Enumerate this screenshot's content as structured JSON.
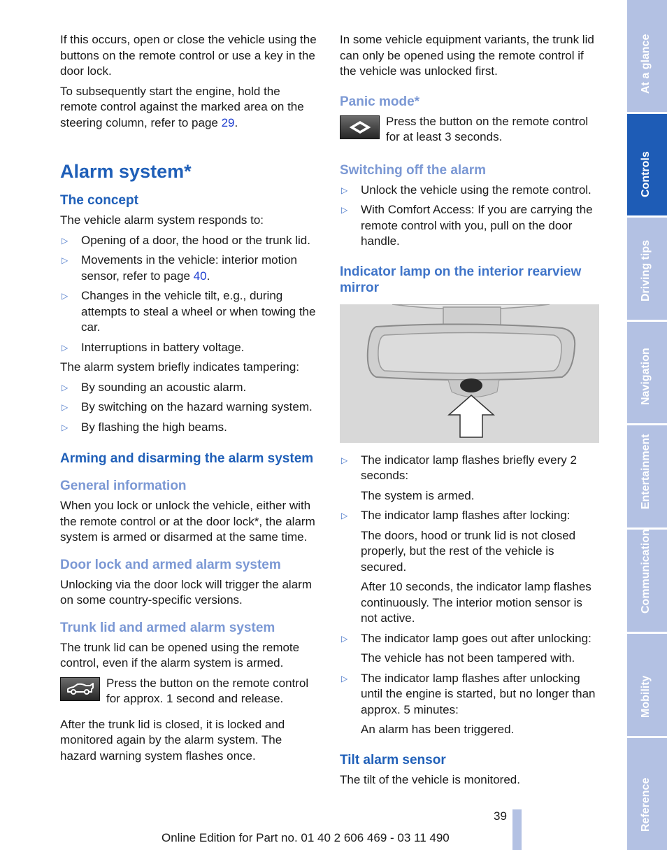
{
  "left_column": {
    "intro_p1": "If this occurs, open or close the vehicle using the buttons on the remote control or use a key in the door lock.",
    "intro_p2_text": "To subsequently start the engine, hold the remote control against the marked area on the steering column, refer to page ",
    "intro_p2_link": "29",
    "intro_p2_end": ".",
    "title": "Alarm system*",
    "concept_heading": "The concept",
    "concept_intro": "The vehicle alarm system responds to:",
    "concept_items": [
      {
        "text": "Opening of a door, the hood or the trunk lid."
      },
      {
        "text": "Movements in the vehicle: interior motion sensor, refer to page ",
        "link": "40",
        "end": "."
      },
      {
        "text": "Changes in the vehicle tilt, e.g., during attempts to steal a wheel or when towing the car."
      },
      {
        "text": "Interruptions in battery voltage."
      }
    ],
    "tamper_intro": "The alarm system briefly indicates tampering:",
    "tamper_items": [
      "By sounding an acoustic alarm.",
      "By switching on the hazard warning system.",
      "By flashing the high beams."
    ],
    "arming_heading": "Arming and disarming the alarm system",
    "general_heading": "General information",
    "general_text": "When you lock or unlock the vehicle, either with the remote control or at the door lock*, the alarm system is armed or disarmed at the same time.",
    "doorlock_heading": "Door lock and armed alarm system",
    "doorlock_text": "Unlocking via the door lock will trigger the alarm on some country-specific versions.",
    "trunk_heading": "Trunk lid and armed alarm system",
    "trunk_text": "The trunk lid can be opened using the remote control, even if the alarm system is armed.",
    "trunk_button_icon": "trunk-car-icon",
    "trunk_button_text": "Press the button on the remote control for approx. 1 second and release.",
    "trunk_after_text": "After the trunk lid is closed, it is locked and monitored again by the alarm system. The hazard warning system flashes once."
  },
  "right_column": {
    "intro_text": "In some vehicle equipment variants, the trunk lid can only be opened using the remote control if the vehicle was unlocked first.",
    "panic_heading": "Panic mode*",
    "panic_button_icon": "panic-diamond-icon",
    "panic_button_text": "Press the button on the remote control for at least 3 seconds.",
    "switchoff_heading": "Switching off the alarm",
    "switchoff_items": [
      "Unlock the vehicle using the remote control.",
      "With Comfort Access: If you are carrying the remote control with you, pull on the door handle."
    ],
    "indicator_heading": "Indicator lamp on the interior rearview mirror",
    "figure_icon": "rearview-mirror-indicator-illustration",
    "indicator_items": [
      {
        "text": "The indicator lamp flashes briefly every 2 seconds:",
        "details": [
          "The system is armed."
        ]
      },
      {
        "text": "The indicator lamp flashes after locking:",
        "details": [
          "The doors, hood or trunk lid is not closed properly, but the rest of the vehicle is secured.",
          "After 10 seconds, the indicator lamp flashes continuously. The interior motion sensor is not active."
        ]
      },
      {
        "text": "The indicator lamp goes out after unlocking:",
        "details": [
          "The vehicle has not been tampered with."
        ]
      },
      {
        "text": "The indicator lamp flashes after unlocking until the engine is started, but no longer than approx. 5 minutes:",
        "details": [
          "An alarm has been triggered."
        ]
      }
    ],
    "tilt_heading": "Tilt alarm sensor",
    "tilt_text": "The tilt of the vehicle is monitored."
  },
  "sidebar": {
    "tabs": [
      {
        "label": "At a glance",
        "active": false
      },
      {
        "label": "Controls",
        "active": true
      },
      {
        "label": "Driving tips",
        "active": false
      },
      {
        "label": "Navigation",
        "active": false
      },
      {
        "label": "Entertainment",
        "active": false
      },
      {
        "label": "Communication",
        "active": false
      },
      {
        "label": "Mobility",
        "active": false
      },
      {
        "label": "Reference",
        "active": false
      }
    ]
  },
  "footer": {
    "page_number": "39",
    "edition_text": "Online Edition for Part no. 01 40 2 606 469 - 03 11 490"
  },
  "colors": {
    "heading_blue": "#1f5fb8",
    "subheading_light_blue": "#7b98d4",
    "tab_inactive": "#b3c1e3",
    "tab_active": "#1e5cb6",
    "link_blue": "#1f3fd0"
  },
  "bullet_glyph": "▷"
}
